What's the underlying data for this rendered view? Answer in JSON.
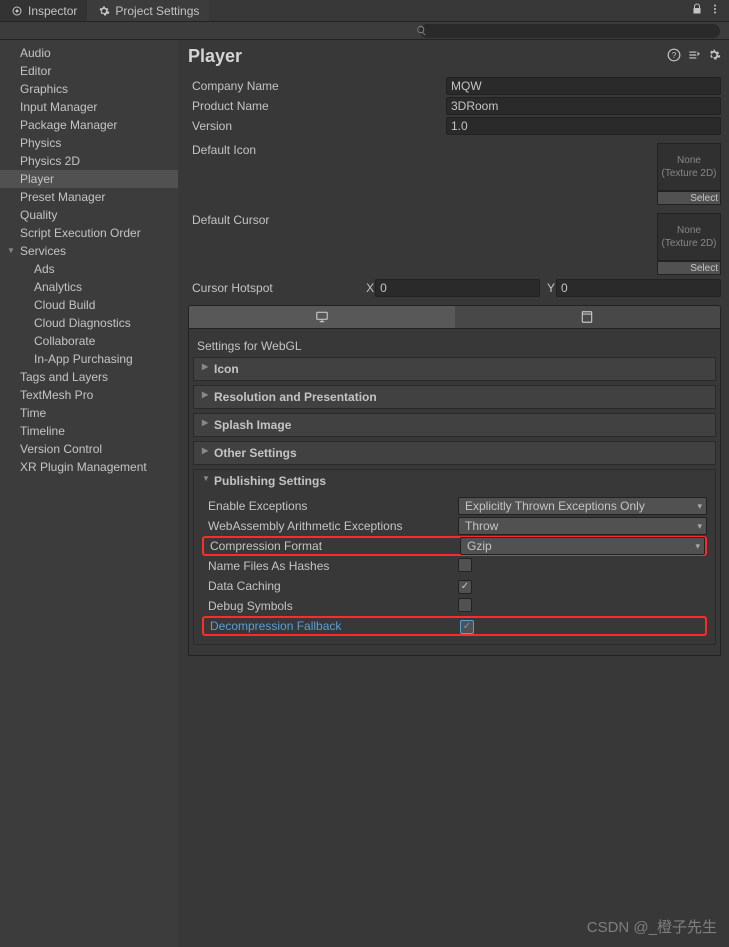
{
  "tabs": {
    "inspector": "Inspector",
    "projectSettings": "Project Settings"
  },
  "sidebar": {
    "items": [
      "Audio",
      "Editor",
      "Graphics",
      "Input Manager",
      "Package Manager",
      "Physics",
      "Physics 2D",
      "Player",
      "Preset Manager",
      "Quality",
      "Script Execution Order",
      "Services",
      "Tags and Layers",
      "TextMesh Pro",
      "Time",
      "Timeline",
      "Version Control",
      "XR Plugin Management"
    ],
    "services": [
      "Ads",
      "Analytics",
      "Cloud Build",
      "Cloud Diagnostics",
      "Collaborate",
      "In-App Purchasing"
    ],
    "selected": "Player"
  },
  "title": "Player",
  "fields": {
    "companyName": {
      "label": "Company Name",
      "value": "MQW"
    },
    "productName": {
      "label": "Product Name",
      "value": "3DRoom"
    },
    "version": {
      "label": "Version",
      "value": "1.0"
    },
    "defaultIcon": {
      "label": "Default Icon",
      "placeholder": "None\n(Texture 2D)",
      "select": "Select"
    },
    "defaultCursor": {
      "label": "Default Cursor",
      "placeholder": "None\n(Texture 2D)",
      "select": "Select"
    },
    "cursorHotspot": {
      "label": "Cursor Hotspot",
      "x": "0",
      "y": "0"
    }
  },
  "settingsFor": "Settings for WebGL",
  "foldouts": {
    "icon": "Icon",
    "resolution": "Resolution and Presentation",
    "splash": "Splash Image",
    "other": "Other Settings",
    "publishing": "Publishing Settings"
  },
  "publishing": {
    "enableExceptions": {
      "label": "Enable Exceptions",
      "value": "Explicitly Thrown Exceptions Only"
    },
    "wasm": {
      "label": "WebAssembly Arithmetic Exceptions",
      "value": "Throw"
    },
    "compression": {
      "label": "Compression Format",
      "value": "Gzip"
    },
    "nameFiles": {
      "label": "Name Files As Hashes",
      "checked": false
    },
    "dataCaching": {
      "label": "Data Caching",
      "checked": true
    },
    "debugSymbols": {
      "label": "Debug Symbols",
      "checked": false
    },
    "decompression": {
      "label": "Decompression Fallback",
      "checked": true
    }
  },
  "watermark": "CSDN @_橙子先生"
}
